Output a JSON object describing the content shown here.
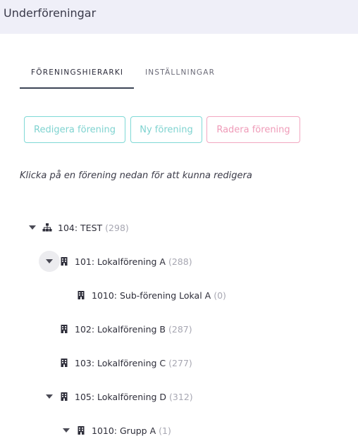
{
  "header": {
    "title": "Underföreningar"
  },
  "tabs": [
    {
      "label": "FÖRENINGSHIERARKI",
      "active": true
    },
    {
      "label": "INSTÄLLNINGAR",
      "active": false
    }
  ],
  "buttons": {
    "edit": "Redigera förening",
    "new": "Ny förening",
    "delete": "Radera förening"
  },
  "colors": {
    "teal": "#7fd9d6",
    "pink": "#f2a7c1"
  },
  "hint": "Klicka på en förening nedan för att kunna redigera",
  "tree": [
    {
      "label": "104: TEST",
      "count": "(298)",
      "icon": "sitemap-icon",
      "expanded": true
    },
    {
      "label": "101: Lokalförening A",
      "count": "(288)",
      "icon": "building-icon",
      "expanded": true
    },
    {
      "label": "1010: Sub-förening Lokal A",
      "count": "(0)",
      "icon": "building-icon"
    },
    {
      "label": "102: Lokalförening B",
      "count": "(287)",
      "icon": "building-icon"
    },
    {
      "label": "103: Lokalförening C",
      "count": "(277)",
      "icon": "building-icon"
    },
    {
      "label": "105: Lokalförening D",
      "count": "(312)",
      "icon": "building-icon",
      "expanded": true
    },
    {
      "label": "1010: Grupp A",
      "count": "(1)",
      "icon": "building-icon",
      "expanded": true
    }
  ]
}
